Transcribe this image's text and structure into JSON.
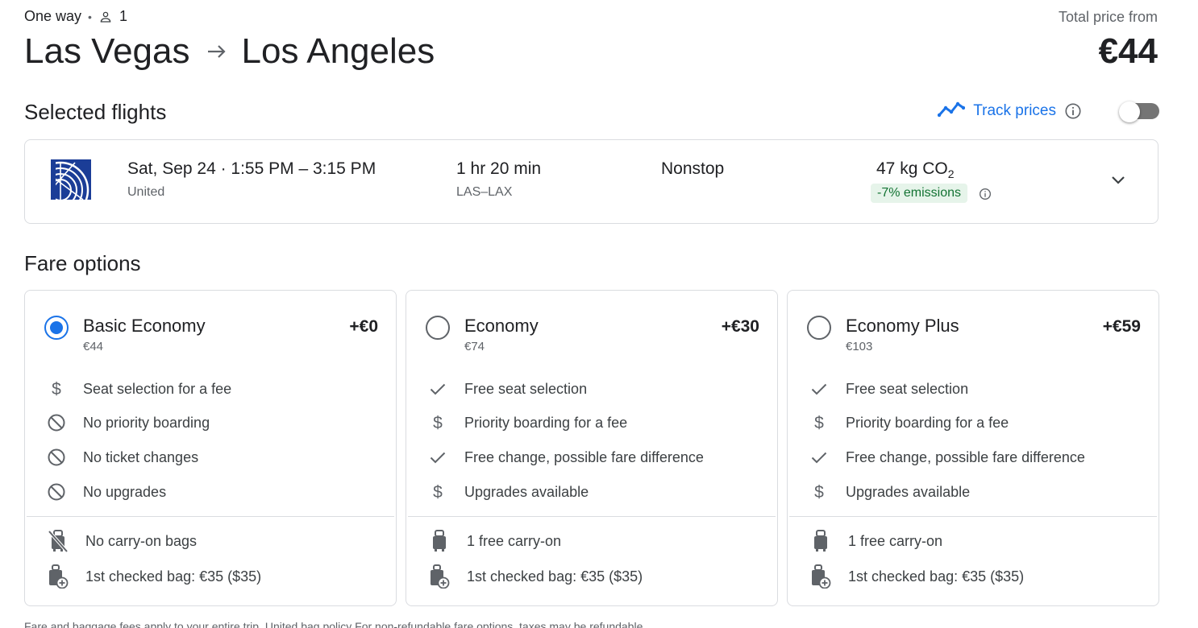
{
  "header": {
    "trip_type": "One way",
    "passengers": "1",
    "origin": "Las Vegas",
    "destination": "Los Angeles",
    "total_label": "Total price from",
    "total_price": "€44"
  },
  "selected_flights": {
    "title": "Selected flights",
    "track_prices_label": "Track prices",
    "track_prices_enabled": false,
    "flight": {
      "date": "Sat, Sep 24",
      "times": "1:55 PM – 3:15 PM",
      "airline": "United",
      "duration": "1 hr 20 min",
      "route": "LAS–LAX",
      "stops": "Nonstop",
      "co2_value": "47 kg CO",
      "co2_sub": "2",
      "emissions_badge": "-7% emissions"
    }
  },
  "fare_options": {
    "title": "Fare options",
    "cards": [
      {
        "name": "Basic Economy",
        "price": "€44",
        "delta": "+€0",
        "selected": true,
        "features": [
          {
            "icon": "dollar-icon",
            "text": "Seat selection for a fee"
          },
          {
            "icon": "blocked-icon",
            "text": "No priority boarding"
          },
          {
            "icon": "blocked-icon",
            "text": "No ticket changes"
          },
          {
            "icon": "blocked-icon",
            "text": "No upgrades"
          }
        ],
        "bags": [
          {
            "icon": "no-carry-on-icon",
            "text": "No carry-on bags"
          },
          {
            "icon": "checked-bag-icon",
            "text": "1st checked bag: €35 ($35)"
          }
        ]
      },
      {
        "name": "Economy",
        "price": "€74",
        "delta": "+€30",
        "selected": false,
        "features": [
          {
            "icon": "check-icon",
            "text": "Free seat selection"
          },
          {
            "icon": "dollar-icon",
            "text": "Priority boarding for a fee"
          },
          {
            "icon": "check-icon",
            "text": "Free change, possible fare difference"
          },
          {
            "icon": "dollar-icon",
            "text": "Upgrades available"
          }
        ],
        "bags": [
          {
            "icon": "carry-on-icon",
            "text": "1 free carry-on"
          },
          {
            "icon": "checked-bag-icon",
            "text": "1st checked bag: €35 ($35)"
          }
        ]
      },
      {
        "name": "Economy Plus",
        "price": "€103",
        "delta": "+€59",
        "selected": false,
        "features": [
          {
            "icon": "check-icon",
            "text": "Free seat selection"
          },
          {
            "icon": "dollar-icon",
            "text": "Priority boarding for a fee"
          },
          {
            "icon": "check-icon",
            "text": "Free change, possible fare difference"
          },
          {
            "icon": "dollar-icon",
            "text": "Upgrades available"
          }
        ],
        "bags": [
          {
            "icon": "carry-on-icon",
            "text": "1 free carry-on"
          },
          {
            "icon": "checked-bag-icon",
            "text": "1st checked bag: €35 ($35)"
          }
        ]
      }
    ]
  },
  "footnote": "Fare and baggage fees apply to your entire trip. United bag policy For non-refundable fare options, taxes may be refundable.",
  "colors": {
    "accent": "#1a73e8",
    "emissions_green": "#137333",
    "emissions_bg": "#e6f4ea",
    "text": "#202124",
    "secondary_text": "#5f6368",
    "border": "#dadce0"
  }
}
